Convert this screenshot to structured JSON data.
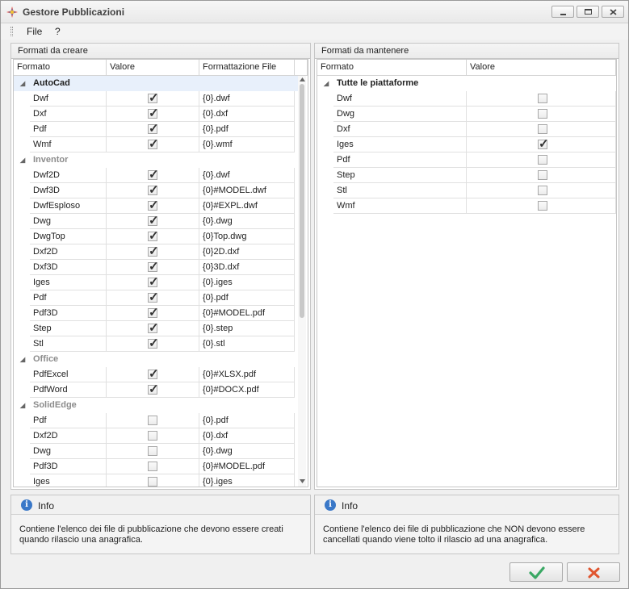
{
  "window": {
    "title": "Gestore Pubblicazioni"
  },
  "menu": {
    "file": "File",
    "help": "?"
  },
  "left_panel": {
    "title": "Formati da creare",
    "columns": [
      "Formato",
      "Valore",
      "Formattazione File"
    ],
    "groups": [
      {
        "name": "AutoCad",
        "selected": true,
        "rows": [
          {
            "format": "Dwf",
            "checked": true,
            "pattern": "{0}.dwf"
          },
          {
            "format": "Dxf",
            "checked": true,
            "pattern": "{0}.dxf"
          },
          {
            "format": "Pdf",
            "checked": true,
            "pattern": "{0}.pdf"
          },
          {
            "format": "Wmf",
            "checked": true,
            "pattern": "{0}.wmf"
          }
        ]
      },
      {
        "name": "Inventor",
        "selected": false,
        "rows": [
          {
            "format": "Dwf2D",
            "checked": true,
            "pattern": "{0}.dwf"
          },
          {
            "format": "Dwf3D",
            "checked": true,
            "pattern": "{0}#MODEL.dwf"
          },
          {
            "format": "DwfEsploso",
            "checked": true,
            "pattern": "{0}#EXPL.dwf"
          },
          {
            "format": "Dwg",
            "checked": true,
            "pattern": "{0}.dwg"
          },
          {
            "format": "DwgTop",
            "checked": true,
            "pattern": "{0}Top.dwg"
          },
          {
            "format": "Dxf2D",
            "checked": true,
            "pattern": "{0}2D.dxf"
          },
          {
            "format": "Dxf3D",
            "checked": true,
            "pattern": "{0}3D.dxf"
          },
          {
            "format": "Iges",
            "checked": true,
            "pattern": "{0}.iges"
          },
          {
            "format": "Pdf",
            "checked": true,
            "pattern": "{0}.pdf"
          },
          {
            "format": "Pdf3D",
            "checked": true,
            "pattern": "{0}#MODEL.pdf"
          },
          {
            "format": "Step",
            "checked": true,
            "pattern": "{0}.step"
          },
          {
            "format": "Stl",
            "checked": true,
            "pattern": "{0}.stl"
          }
        ]
      },
      {
        "name": "Office",
        "selected": false,
        "rows": [
          {
            "format": "PdfExcel",
            "checked": true,
            "pattern": "{0}#XLSX.pdf"
          },
          {
            "format": "PdfWord",
            "checked": true,
            "pattern": "{0}#DOCX.pdf"
          }
        ]
      },
      {
        "name": "SolidEdge",
        "selected": false,
        "rows": [
          {
            "format": "Pdf",
            "checked": false,
            "pattern": "{0}.pdf"
          },
          {
            "format": "Dxf2D",
            "checked": false,
            "pattern": "{0}.dxf"
          },
          {
            "format": "Dwg",
            "checked": false,
            "pattern": "{0}.dwg"
          },
          {
            "format": "Pdf3D",
            "checked": false,
            "pattern": "{0}#MODEL.pdf"
          },
          {
            "format": "Iges",
            "checked": false,
            "pattern": "{0}.iges"
          }
        ]
      }
    ],
    "info_title": "Info",
    "info_text": "Contiene l'elenco dei file di pubblicazione che devono essere creati quando rilascio una anagrafica."
  },
  "right_panel": {
    "title": "Formati da mantenere",
    "columns": [
      "Formato",
      "Valore"
    ],
    "group": "Tutte le piattaforme",
    "rows": [
      {
        "format": "Dwf",
        "checked": false
      },
      {
        "format": "Dwg",
        "checked": false
      },
      {
        "format": "Dxf",
        "checked": false
      },
      {
        "format": "Iges",
        "checked": true
      },
      {
        "format": "Pdf",
        "checked": false
      },
      {
        "format": "Step",
        "checked": false
      },
      {
        "format": "Stl",
        "checked": false
      },
      {
        "format": "Wmf",
        "checked": false
      }
    ],
    "info_title": "Info",
    "info_text": "Contiene l'elenco dei file di pubblicazione che NON devono essere cancellati quando viene tolto il rilascio ad una anagrafica."
  },
  "colors": {
    "ok": "#3aa864",
    "cancel": "#e0552f",
    "selected_row": "#e8f0fb"
  }
}
